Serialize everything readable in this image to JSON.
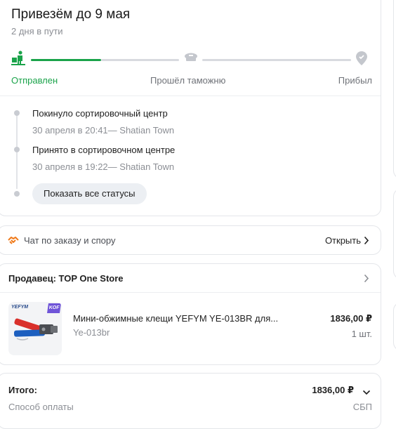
{
  "delivery": {
    "title": "Привезём до 9 мая",
    "subtitle": "2 дня в пути",
    "steps": [
      {
        "label": "Отправлен",
        "icon": "courier-icon",
        "active": true
      },
      {
        "label": "Прошёл таможню",
        "icon": "customs-cap-icon",
        "active": false
      },
      {
        "label": "Прибыл",
        "icon": "location-pin-icon",
        "active": false
      }
    ],
    "progress": 0.25,
    "events": [
      {
        "title": "Покинуло сортировочный центр",
        "detail": "30 апреля в 20:41— Shatian Town"
      },
      {
        "title": "Принято в сортировочном центре",
        "detail": "30 апреля в 19:22— Shatian Town"
      }
    ],
    "show_all_label": "Показать все статусы"
  },
  "chat": {
    "label": "Чат по заказу и спору",
    "open_label": "Открыть",
    "icon": "handshake-icon"
  },
  "seller": {
    "title": "Продавец: TOP One Store",
    "product": {
      "brand": "YEFYM",
      "badge": "KOF",
      "name": "Мини-обжимные клещи YEFYM YE-013BR для...",
      "sku": "Ye-013br",
      "price": "1836,00 ₽",
      "qty": "1 шт."
    }
  },
  "total": {
    "label": "Итого:",
    "value": "1836,00 ₽",
    "payment_label": "Способ оплаты",
    "payment_value": "СБП"
  },
  "colors": {
    "accent": "#1aa34a",
    "muted": "#8b8e94",
    "chat_icon": "#f07a1a"
  }
}
